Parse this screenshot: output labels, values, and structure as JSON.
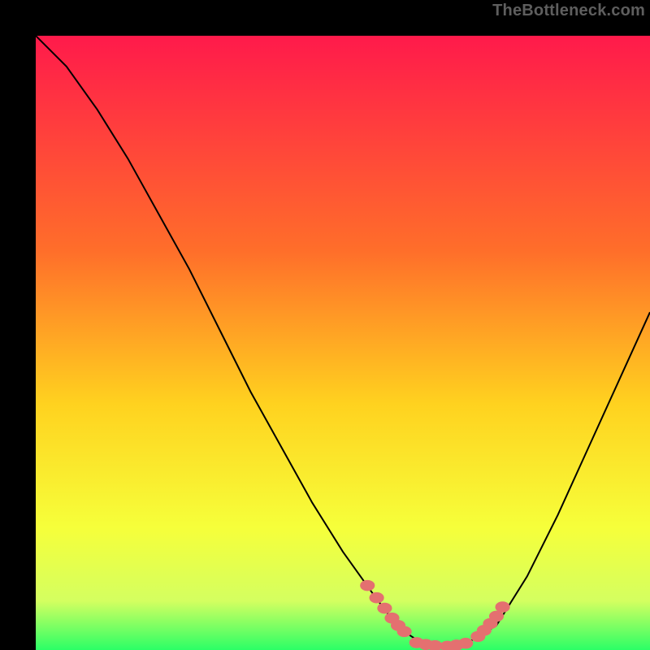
{
  "attribution": "TheBottleneck.com",
  "chart_data": {
    "type": "line",
    "title": "",
    "xlabel": "",
    "ylabel": "",
    "xlim": [
      0,
      100
    ],
    "ylim": [
      0,
      100
    ],
    "gradient_stops": [
      {
        "offset": 0,
        "color": "#ff1a4b"
      },
      {
        "offset": 35,
        "color": "#ff6e2a"
      },
      {
        "offset": 60,
        "color": "#ffd21f"
      },
      {
        "offset": 80,
        "color": "#f6ff3a"
      },
      {
        "offset": 92,
        "color": "#d4ff60"
      },
      {
        "offset": 100,
        "color": "#2bff66"
      }
    ],
    "series": [
      {
        "name": "bottleneck-curve",
        "type": "line",
        "color": "#000000",
        "x": [
          0,
          5,
          10,
          15,
          20,
          25,
          30,
          35,
          40,
          45,
          50,
          55,
          58,
          60,
          63,
          66,
          70,
          75,
          80,
          85,
          90,
          95,
          100
        ],
        "y": [
          100,
          95,
          88,
          80,
          71,
          62,
          52,
          42,
          33,
          24,
          16,
          9,
          5,
          3,
          1,
          0.5,
          1,
          4,
          12,
          22,
          33,
          44,
          55
        ]
      },
      {
        "name": "markers-left",
        "type": "scatter",
        "color": "#e47070",
        "x": [
          54,
          55.5,
          56.8,
          58,
          59,
          60
        ],
        "y": [
          10.5,
          8.5,
          6.8,
          5.2,
          4,
          3
        ]
      },
      {
        "name": "markers-bottom",
        "type": "scatter",
        "color": "#e47070",
        "x": [
          62,
          63.5,
          65,
          67,
          68.5,
          70
        ],
        "y": [
          1.2,
          0.9,
          0.7,
          0.6,
          0.8,
          1.1
        ]
      },
      {
        "name": "markers-right",
        "type": "scatter",
        "color": "#e47070",
        "x": [
          72,
          73,
          74,
          75,
          76
        ],
        "y": [
          2.2,
          3.2,
          4.3,
          5.5,
          7
        ]
      }
    ]
  }
}
